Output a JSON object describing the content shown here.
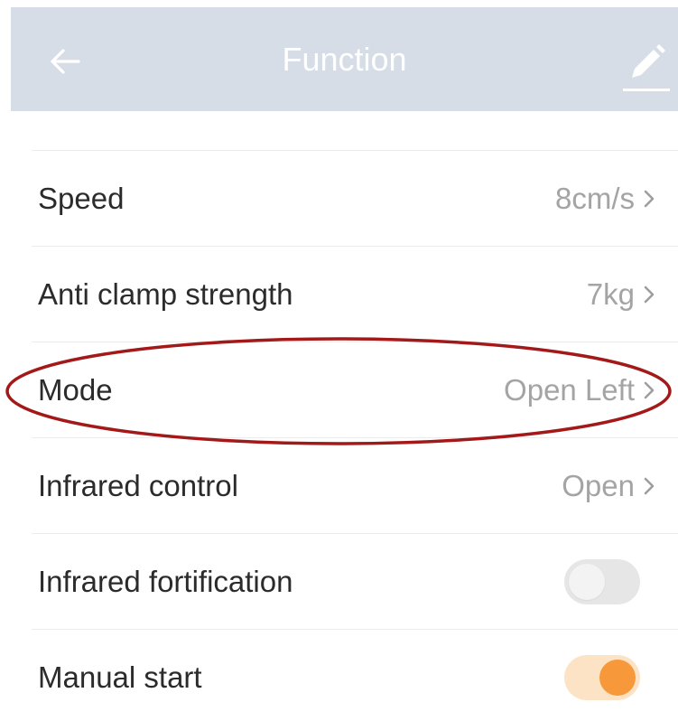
{
  "header": {
    "title": "Function",
    "back_icon": "arrow-left-icon",
    "edit_icon": "pencil-icon",
    "background_color": "#d6dde6"
  },
  "settings": [
    {
      "label": "Speed",
      "value": "8cm/s",
      "type": "link"
    },
    {
      "label": "Anti clamp strength",
      "value": "7kg",
      "type": "link"
    },
    {
      "label": "Mode",
      "value": "Open Left",
      "type": "link"
    },
    {
      "label": "Infrared control",
      "value": "Open",
      "type": "link"
    },
    {
      "label": "Infrared fortification",
      "type": "toggle",
      "enabled": false
    },
    {
      "label": "Manual start",
      "type": "toggle",
      "enabled": true
    }
  ],
  "colors": {
    "accent": "#f7993a",
    "highlight_ellipse": "#a31919",
    "value_text": "#a4a4a4"
  }
}
